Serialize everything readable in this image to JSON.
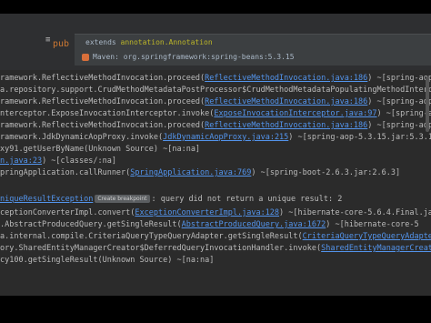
{
  "editor": {
    "gutter_glyph": "≡",
    "keyword_fragment": "pub",
    "popup": {
      "line1_prefix": "extends ",
      "line1_annotation": "annotation.Annotation",
      "line2": "Maven: org.springframework:spring-beans:5.3.15"
    }
  },
  "console": {
    "lines": [
      {
        "parts": [
          {
            "t": "ramework.ReflectiveMethodInvocation.proceed(",
            "c": "plain"
          },
          {
            "t": "ReflectiveMethodInvocation.java:186",
            "c": "link"
          },
          {
            "t": ") ~[spring-aop-5",
            "c": "plain"
          }
        ]
      },
      {
        "parts": [
          {
            "t": "a.repository.support.CrudMethodMetadataPostProcessor$CrudMethodMetadataPopulatingMethodInterc",
            "c": "plain"
          }
        ]
      },
      {
        "parts": [
          {
            "t": "ramework.ReflectiveMethodInvocation.proceed(",
            "c": "plain"
          },
          {
            "t": "ReflectiveMethodInvocation.java:186",
            "c": "link"
          },
          {
            "t": ") ~[spring-aop-5",
            "c": "plain"
          }
        ]
      },
      {
        "parts": [
          {
            "t": "nterceptor.ExposeInvocationInterceptor.invoke(",
            "c": "plain"
          },
          {
            "t": "ExposeInvocationInterceptor.java:97",
            "c": "link"
          },
          {
            "t": ") ~[spring-aop-",
            "c": "plain"
          }
        ]
      },
      {
        "parts": [
          {
            "t": "ramework.ReflectiveMethodInvocation.proceed(",
            "c": "plain"
          },
          {
            "t": "ReflectiveMethodInvocation.java:186",
            "c": "link"
          },
          {
            "t": ") ~[spring-aop-5",
            "c": "plain"
          }
        ]
      },
      {
        "parts": [
          {
            "t": "ramework.JdkDynamicAopProxy.invoke(",
            "c": "plain"
          },
          {
            "t": "JdkDynamicAopProxy.java:215",
            "c": "link"
          },
          {
            "t": ") ~[spring-aop-5.3.15.jar:5.3.15]",
            "c": "plain"
          }
        ]
      },
      {
        "parts": [
          {
            "t": "xy91.getUserByName(Unknown Source) ~[na:na]",
            "c": "plain"
          }
        ]
      },
      {
        "parts": [
          {
            "t": "n.java:23",
            "c": "link"
          },
          {
            "t": ") ~[classes/:na]",
            "c": "plain"
          }
        ]
      },
      {
        "parts": [
          {
            "t": "pringApplication.callRunner(",
            "c": "plain"
          },
          {
            "t": "SpringApplication.java:769",
            "c": "link"
          },
          {
            "t": ") ~[spring-boot-2.6.3.jar:2.6.3]",
            "c": "plain"
          }
        ]
      },
      {
        "parts": [
          {
            "t": "",
            "c": "plain"
          }
        ]
      },
      {
        "parts": [
          {
            "t": "niqueResultException",
            "c": "exc"
          },
          {
            "t": "Create breakpoint",
            "c": "badge"
          },
          {
            "t": ": query did not return a unique result: 2",
            "c": "plain"
          }
        ]
      },
      {
        "parts": [
          {
            "t": "ceptionConverterImpl.convert(",
            "c": "plain"
          },
          {
            "t": "ExceptionConverterImpl.java:128",
            "c": "link"
          },
          {
            "t": ") ~[hibernate-core-5.6.4.Final.jar:5",
            "c": "plain"
          }
        ]
      },
      {
        "parts": [
          {
            "t": ".AbstractProducedQuery.getSingleResult(",
            "c": "plain"
          },
          {
            "t": "AbstractProducedQuery.java:1672",
            "c": "link"
          },
          {
            "t": ") ~[hibernate-core-5",
            "c": "plain"
          }
        ]
      },
      {
        "parts": [
          {
            "t": "a.internal.compile.CriteriaQueryTypeQueryAdapter.getSingleResult(",
            "c": "plain"
          },
          {
            "t": "CriteriaQueryTypeQueryAdapte",
            "c": "link"
          }
        ]
      },
      {
        "parts": [
          {
            "t": "ory.SharedEntityManagerCreator$DeferredQueryInvocationHandler.invoke(",
            "c": "plain"
          },
          {
            "t": "SharedEntityManagerCreator",
            "c": "link"
          }
        ]
      },
      {
        "parts": [
          {
            "t": "cy100.getSingleResult(Unknown Source) ~[na:na]",
            "c": "plain"
          }
        ]
      }
    ]
  }
}
